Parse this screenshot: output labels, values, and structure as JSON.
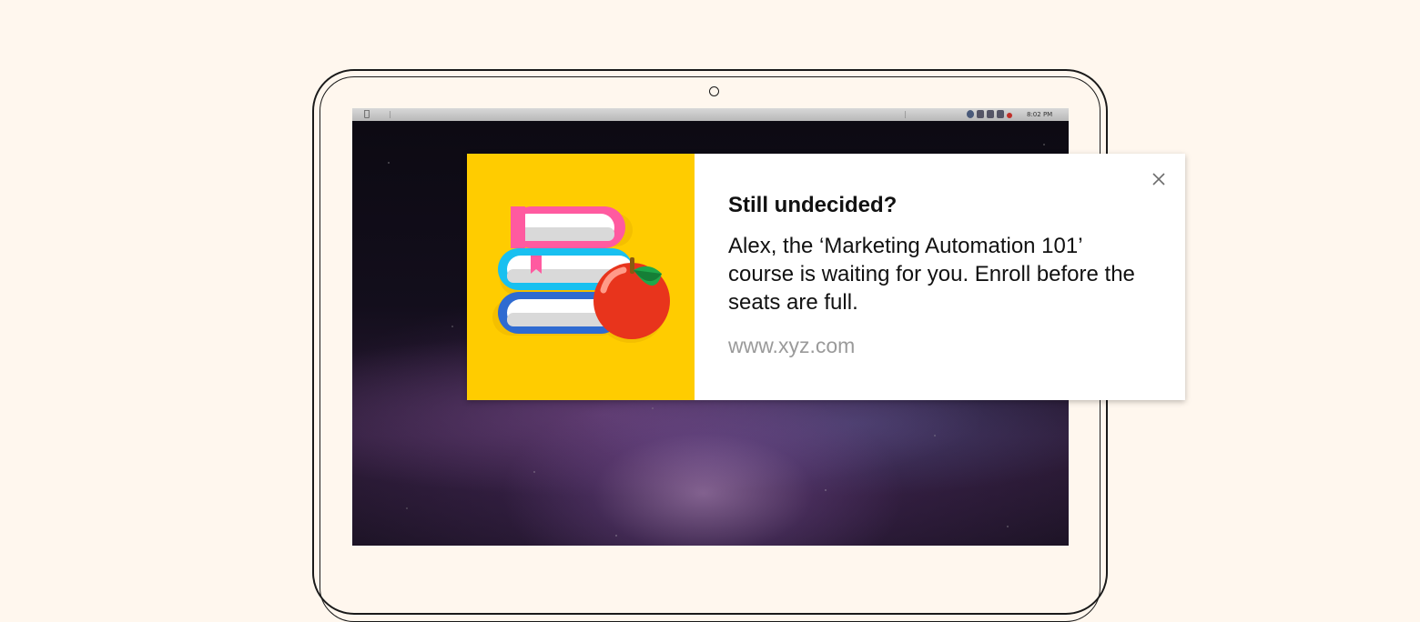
{
  "device": {
    "menubar": {
      "apple_icon": "apple-icon",
      "clock": "8:02 PM"
    }
  },
  "notification": {
    "title": "Still undecided?",
    "body": "Alex, the ‘Marketing Automation 101’ course is waiting for you. Enroll before the seats are full.",
    "url": "www.xyz.com",
    "image_icon": "books-and-apple-illustration",
    "close_icon": "close-icon",
    "colors": {
      "image_background": "#ffcc00",
      "title": "#111111",
      "url": "#9a9a9a"
    }
  }
}
